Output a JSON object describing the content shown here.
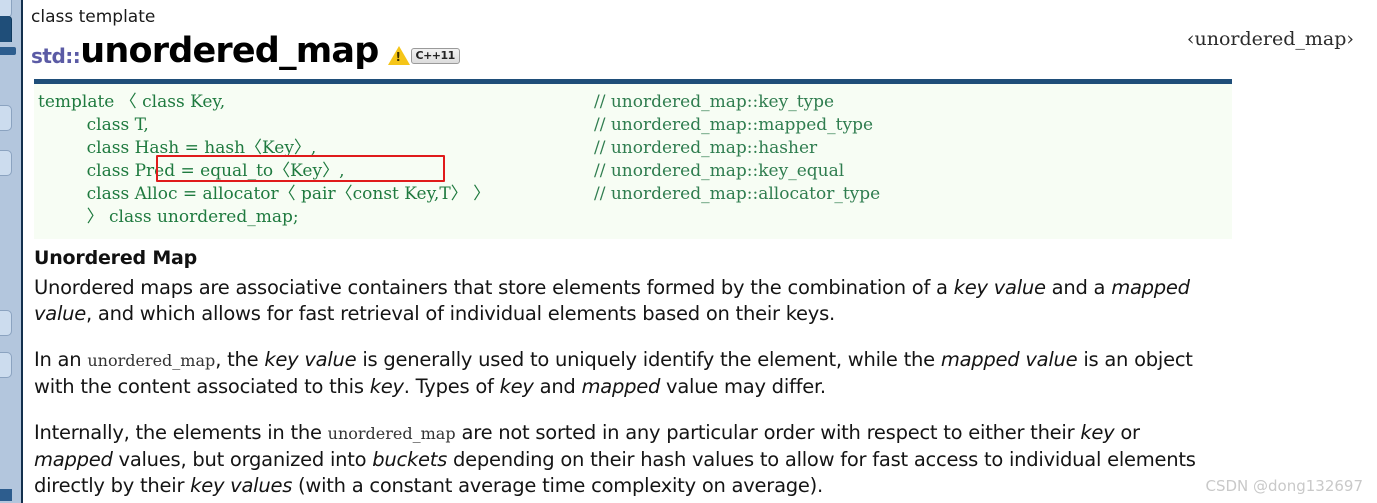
{
  "chrome": {
    "tab_stub_label": "",
    "active_tab_label": ""
  },
  "header": {
    "kicker": "class template",
    "namespace_prefix": "std::",
    "title": "unordered_map",
    "warning_icon": "warning-triangle-icon",
    "std_badge": "C++11",
    "include_header": "‹unordered_map›"
  },
  "code": {
    "lines": [
      {
        "decl": "template 〈 class Key,",
        "comment": "// unordered_map::key_type"
      },
      {
        "decl": "         class T,",
        "comment": "// unordered_map::mapped_type"
      },
      {
        "decl": "         class Hash = hash〈Key〉,",
        "comment": "// unordered_map::hasher"
      },
      {
        "decl": "         class Pred = equal_to〈Key〉,",
        "comment": "// unordered_map::key_equal"
      },
      {
        "decl": "         class Alloc = allocator〈 pair〈const Key,T〉 〉",
        "comment": "// unordered_map::allocator_type"
      },
      {
        "decl": "         〉 class unordered_map;",
        "comment": ""
      }
    ],
    "highlight_line_index": 3
  },
  "section": {
    "title": "Unordered Map",
    "paragraphs": [
      [
        {
          "t": "Unordered maps are associative containers that store elements formed by the combination of a ",
          "s": "plain"
        },
        {
          "t": "key value",
          "s": "em"
        },
        {
          "t": " and a ",
          "s": "plain"
        },
        {
          "t": "mapped value",
          "s": "em"
        },
        {
          "t": ", and which allows for fast retrieval of individual elements based on their keys.",
          "s": "plain"
        }
      ],
      [
        {
          "t": "In an ",
          "s": "plain"
        },
        {
          "t": "unordered_map",
          "s": "code"
        },
        {
          "t": ", the ",
          "s": "plain"
        },
        {
          "t": "key value",
          "s": "em"
        },
        {
          "t": " is generally used to uniquely identify the element, while the ",
          "s": "plain"
        },
        {
          "t": "mapped value",
          "s": "em"
        },
        {
          "t": " is an object with the content associated to this ",
          "s": "plain"
        },
        {
          "t": "key",
          "s": "em"
        },
        {
          "t": ". Types of ",
          "s": "plain"
        },
        {
          "t": "key",
          "s": "em"
        },
        {
          "t": " and ",
          "s": "plain"
        },
        {
          "t": "mapped",
          "s": "em"
        },
        {
          "t": " value may differ.",
          "s": "plain"
        }
      ],
      [
        {
          "t": "Internally, the elements in the ",
          "s": "plain"
        },
        {
          "t": "unordered_map",
          "s": "code"
        },
        {
          "t": " are not sorted in any particular order with respect to either their ",
          "s": "plain"
        },
        {
          "t": "key",
          "s": "em"
        },
        {
          "t": " or ",
          "s": "plain"
        },
        {
          "t": "mapped",
          "s": "em"
        },
        {
          "t": " values, but organized into ",
          "s": "plain"
        },
        {
          "t": "buckets",
          "s": "em"
        },
        {
          "t": " depending on their hash values to allow for fast access to individual elements directly by their ",
          "s": "plain"
        },
        {
          "t": "key values",
          "s": "em"
        },
        {
          "t": " (with a constant average time complexity on average).",
          "s": "plain"
        }
      ]
    ]
  },
  "watermark": "CSDN @dong132697",
  "colors": {
    "code_text": "#1f7a3f",
    "code_bg": "#f7fdf4",
    "code_top_border": "#1f4e79",
    "highlight_border": "#e01b1b",
    "namespace": "#5b5ba5",
    "chrome": "#b3c6dd"
  }
}
